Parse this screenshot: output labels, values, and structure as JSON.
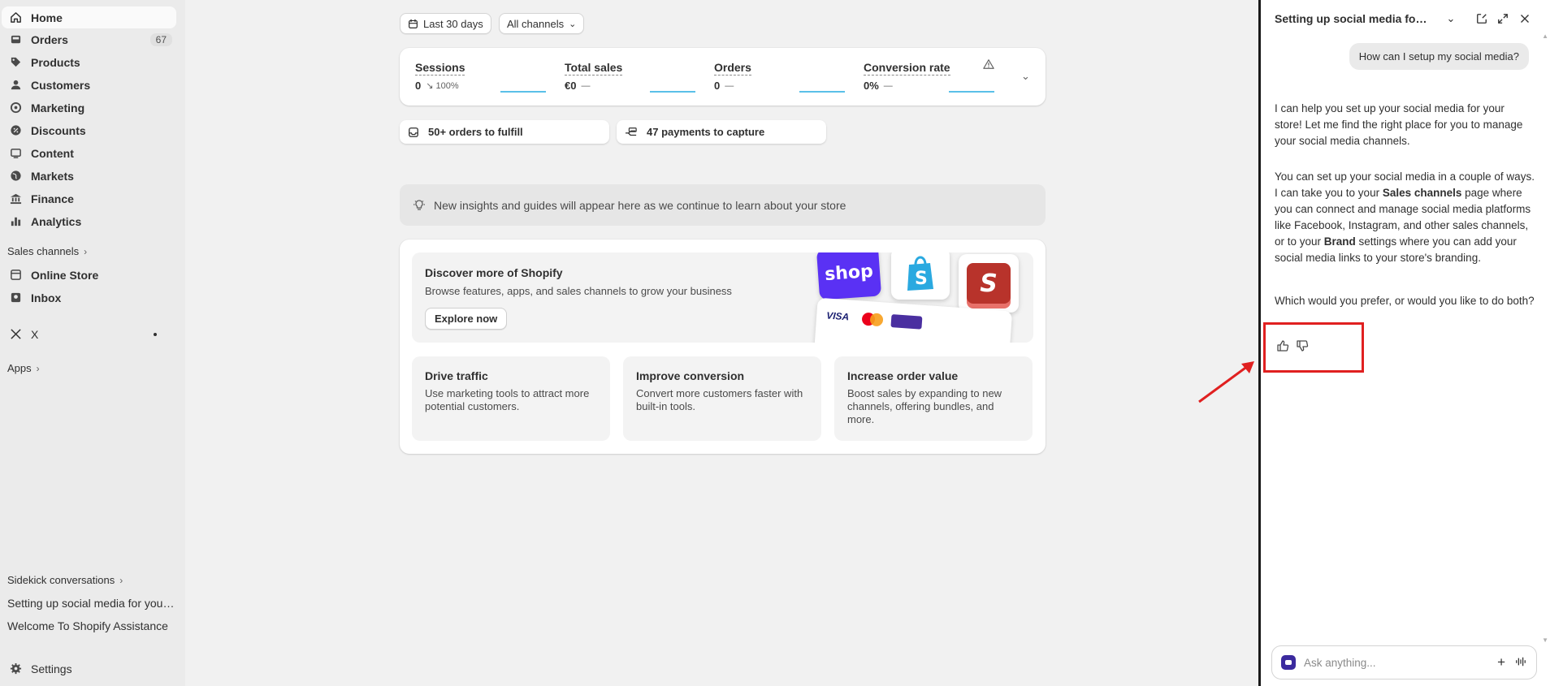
{
  "sidebar": {
    "items": [
      {
        "label": "Home",
        "icon": "home-icon",
        "active": true
      },
      {
        "label": "Orders",
        "icon": "orders-icon",
        "badge": "67"
      },
      {
        "label": "Products",
        "icon": "tag-icon"
      },
      {
        "label": "Customers",
        "icon": "person-icon"
      },
      {
        "label": "Marketing",
        "icon": "target-icon"
      },
      {
        "label": "Discounts",
        "icon": "discount-icon"
      },
      {
        "label": "Content",
        "icon": "content-icon"
      },
      {
        "label": "Markets",
        "icon": "globe-icon"
      },
      {
        "label": "Finance",
        "icon": "bank-icon"
      },
      {
        "label": "Analytics",
        "icon": "bar-chart-icon"
      }
    ],
    "sales_channels_label": "Sales channels",
    "channels": [
      {
        "label": "Online Store",
        "icon": "store-icon"
      },
      {
        "label": "Inbox",
        "icon": "inbox-icon"
      }
    ],
    "x_label": "X",
    "apps_label": "Apps",
    "sidekick_conversations_label": "Sidekick conversations",
    "conversations": [
      "Setting up social media for your store",
      "Welcome To Shopify Assistance"
    ],
    "settings_label": "Settings"
  },
  "filters": {
    "date_range": "Last 30 days",
    "channels": "All channels"
  },
  "metrics": [
    {
      "label": "Sessions",
      "value": "0",
      "delta": "↘ 100%"
    },
    {
      "label": "Total sales",
      "value": "€0",
      "delta": "—"
    },
    {
      "label": "Orders",
      "value": "0",
      "delta": "—"
    },
    {
      "label": "Conversion rate",
      "value": "0%",
      "delta": "—"
    }
  ],
  "tasks": {
    "orders_to_fulfill": "50+ orders to fulfill",
    "payments_to_capture": "47 payments to capture"
  },
  "insight_text": "New insights and guides will appear here as we continue to learn about your store",
  "discover": {
    "title": "Discover more of Shopify",
    "subtitle": "Browse features, apps, and sales channels to grow your business",
    "button": "Explore now",
    "shop_tile": "shop",
    "visa": "VISA"
  },
  "features": [
    {
      "title": "Drive traffic",
      "desc": "Use marketing tools to attract more potential customers."
    },
    {
      "title": "Improve conversion",
      "desc": "Convert more customers faster with built-in tools."
    },
    {
      "title": "Increase order value",
      "desc": "Boost sales by expanding to new channels, offering bundles, and more."
    }
  ],
  "sidekick": {
    "title": "Setting up social media for your store",
    "user_message": "How can I setup my social media?",
    "reply_1": "I can help you set up your social media for your store! Let me find the right place for you to manage your social media channels.",
    "reply_2_a": "You can set up your social media in a couple of ways. I can take you to your ",
    "reply_2_b": "Sales channels",
    "reply_2_c": " page where you can connect and manage social media platforms like Facebook, Instagram, and other sales channels, or to your ",
    "reply_2_d": "Brand",
    "reply_2_e": " settings where you can add your social media links to your store's branding.",
    "reply_3": "Which would you prefer, or would you like to do both?",
    "ask_placeholder": "Ask anything..."
  },
  "colors": {
    "highlight": "#e02020",
    "spark": "#5ac0e8",
    "shop_purple": "#5a31f4"
  }
}
